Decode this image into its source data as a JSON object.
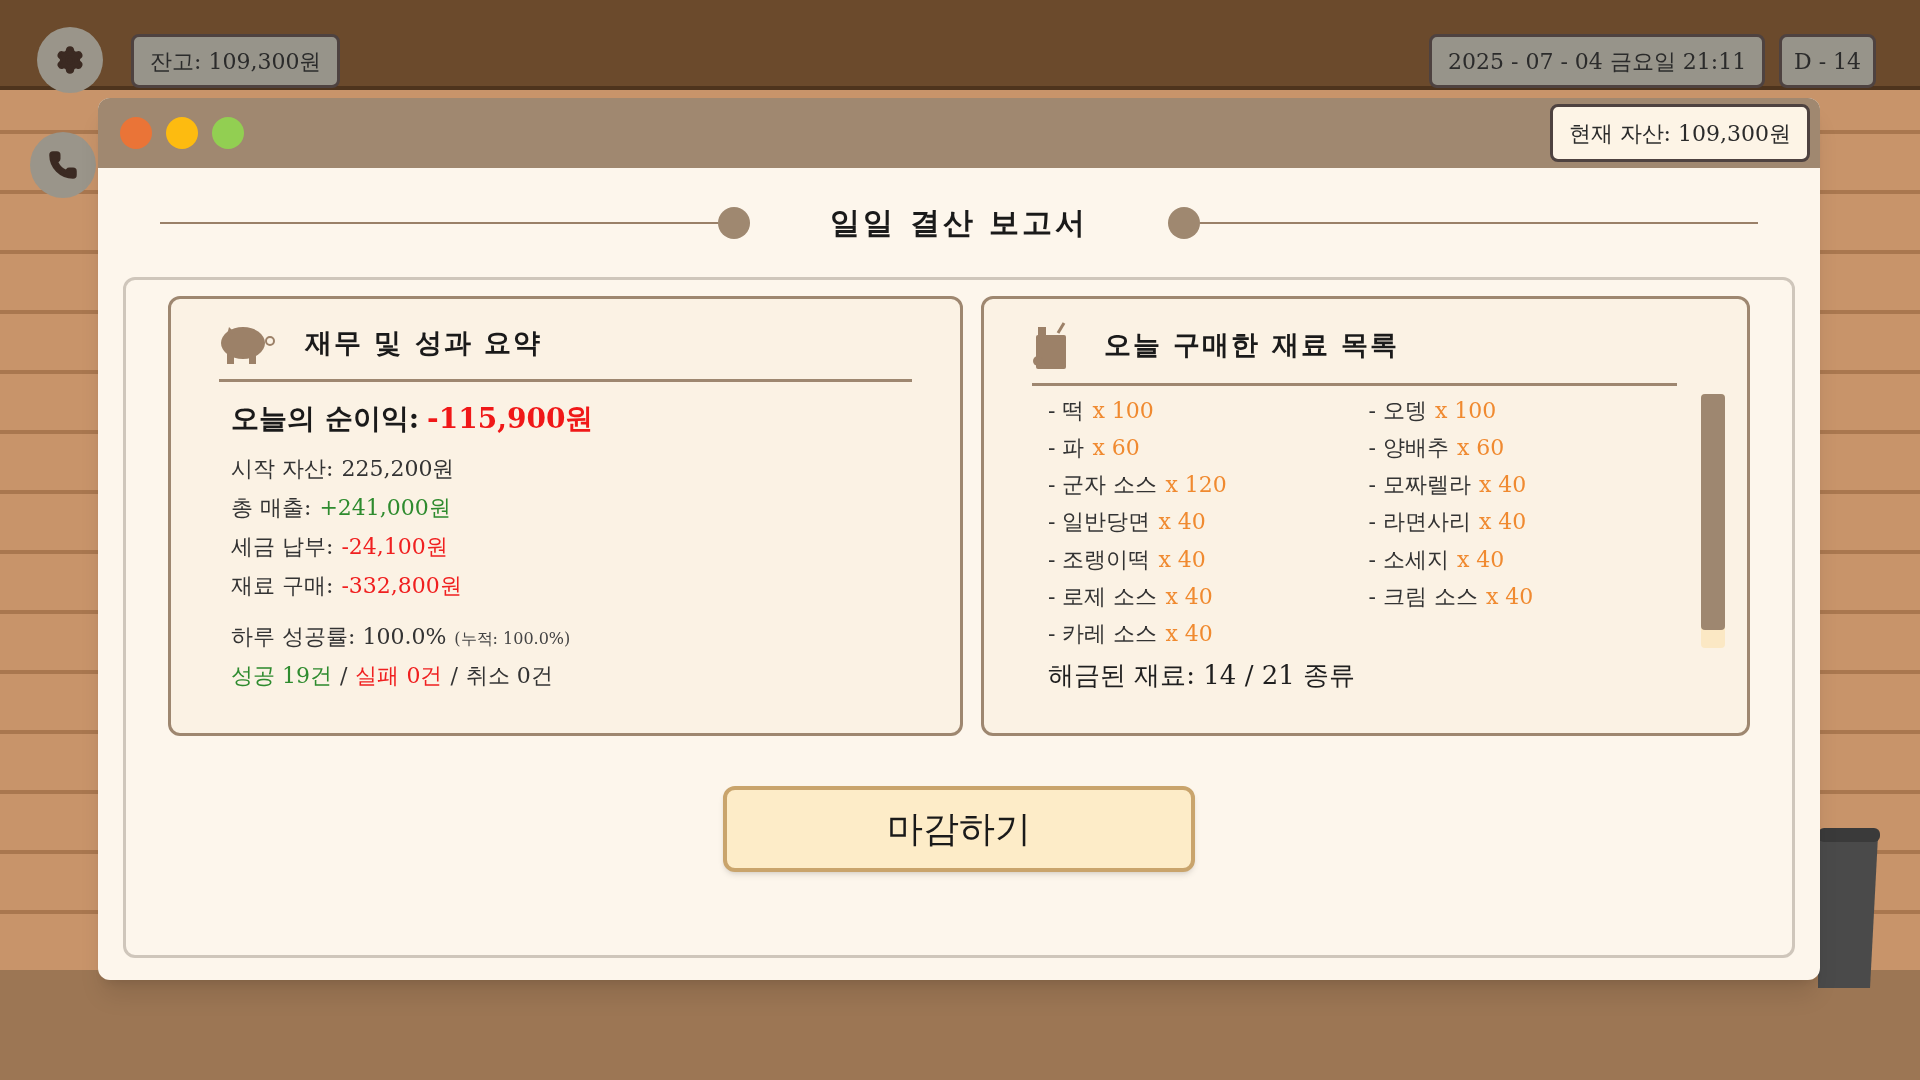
{
  "hud": {
    "balance": "잔고: 109,300원",
    "datetime": "2025 - 07 - 04 금요일 21:11",
    "dday": "D - 14"
  },
  "window": {
    "current_assets": "현재 자산: 109,300원",
    "title": "일일 결산 보고서"
  },
  "summary": {
    "title": "재무 및 성과 요약",
    "net_profit_label": "오늘의 순이익:",
    "net_profit_value": "-115,900원",
    "lines": [
      {
        "label": "시작 자산:",
        "value": "225,200원",
        "kind": "neutral"
      },
      {
        "label": "총 매출:",
        "value": "+241,000원",
        "kind": "positive"
      },
      {
        "label": "세금 납부:",
        "value": "-24,100원",
        "kind": "negative"
      },
      {
        "label": "재료 구매:",
        "value": "-332,800원",
        "kind": "negative"
      }
    ],
    "success_rate": "하루 성공률: 100.0%",
    "cumulative": "(누적: 100.0%)",
    "counts": [
      {
        "text": "성공 19건",
        "kind": "positive"
      },
      {
        "separator": "/",
        "text": "실패 0건",
        "kind": "negative"
      },
      {
        "separator": "/",
        "text": "취소 0건",
        "kind": "neutral"
      }
    ]
  },
  "ingredients": {
    "title": "오늘 구매한 재료 목록",
    "items": [
      {
        "name": "- 떡",
        "qty": "x 100"
      },
      {
        "name": "- 파",
        "qty": "x 60"
      },
      {
        "name": "- 군자 소스",
        "qty": "x 120"
      },
      {
        "name": "- 일반당면",
        "qty": "x 40"
      },
      {
        "name": "- 조랭이떡",
        "qty": "x 40"
      },
      {
        "name": "- 로제 소스",
        "qty": "x 40"
      },
      {
        "name": "- 카레 소스",
        "qty": "x 40"
      },
      {
        "name": "- 오뎅",
        "qty": "x 100"
      },
      {
        "name": "- 양배추",
        "qty": "x 60"
      },
      {
        "name": "- 모짜렐라",
        "qty": "x 40"
      },
      {
        "name": "- 라면사리",
        "qty": "x 40"
      },
      {
        "name": "- 소세지",
        "qty": "x 40"
      },
      {
        "name": "- 크림 소스",
        "qty": "x 40"
      }
    ],
    "unlocked": "해금된 재료: 14 / 21 종류"
  },
  "close_button": "마감하기"
}
